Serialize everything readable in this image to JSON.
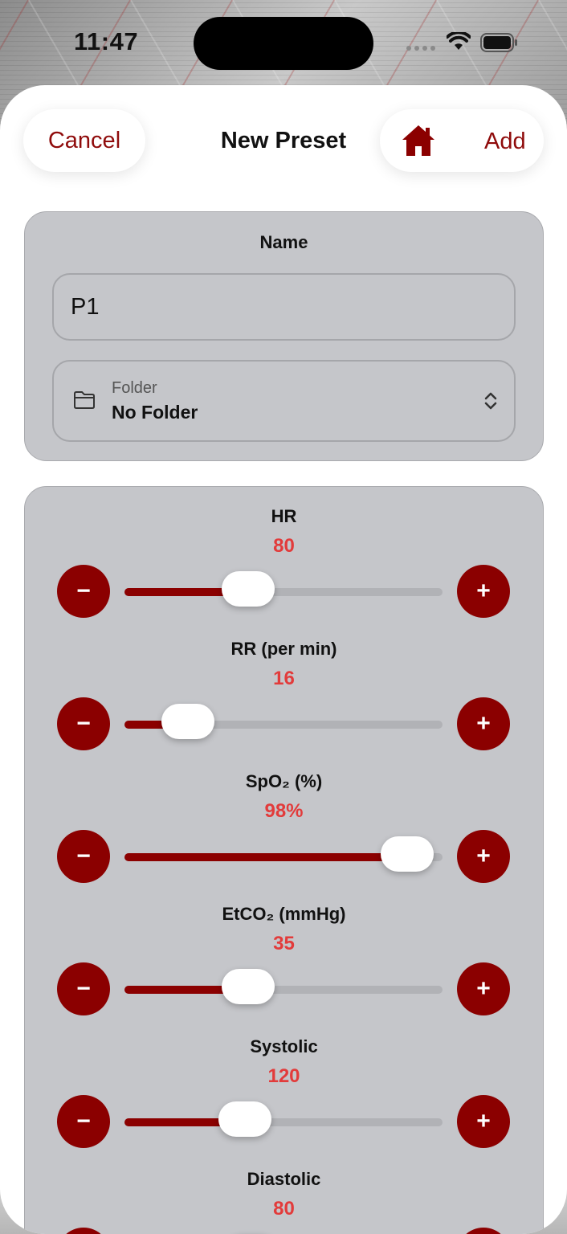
{
  "status_bar": {
    "time": "11:47"
  },
  "nav": {
    "cancel_label": "Cancel",
    "title": "New Preset",
    "add_label": "Add"
  },
  "name_section": {
    "label": "Name",
    "name_value": "P1",
    "folder_caption": "Folder",
    "folder_value": "No Folder"
  },
  "vitals": [
    {
      "label": "HR",
      "value": "80",
      "level": 0.39
    },
    {
      "label": "RR (per min)",
      "value": "16",
      "level": 0.2
    },
    {
      "label": "SpO₂ (%)",
      "value": "98%",
      "level": 0.89
    },
    {
      "label": "EtCO₂ (mmHg)",
      "value": "35",
      "level": 0.39
    },
    {
      "label": "Systolic",
      "value": "120",
      "level": 0.38
    },
    {
      "label": "Diastolic",
      "value": "80",
      "level": 0.4
    }
  ],
  "colors": {
    "accent": "#8b0000",
    "value_text": "#e23b3b",
    "card": "#c5c6ca"
  },
  "icons": {
    "home": "home-icon",
    "folder": "folder-icon",
    "chevrons": "chevron-updown-icon"
  }
}
